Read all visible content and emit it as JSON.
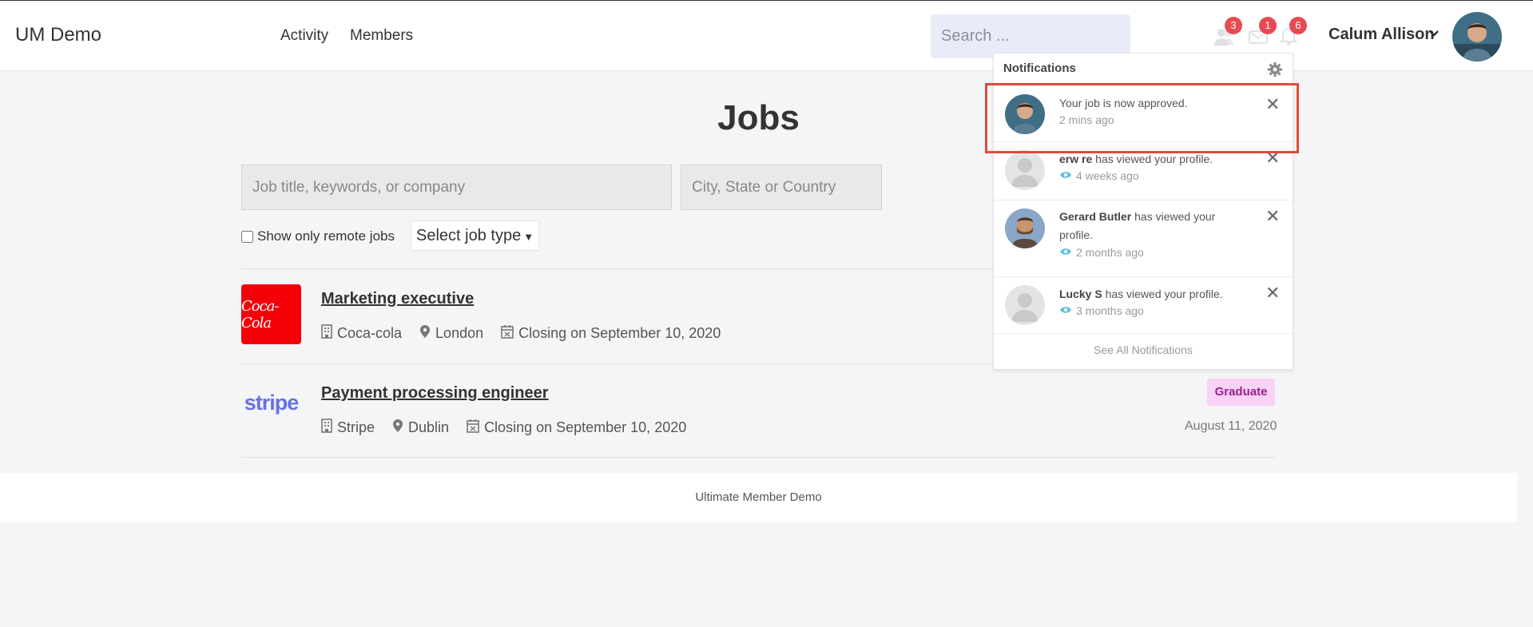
{
  "header": {
    "brand": "UM Demo",
    "nav": [
      "Activity",
      "Members"
    ],
    "search_placeholder": "Search ...",
    "badges": {
      "friends": "3",
      "messages": "1",
      "notifications": "6"
    },
    "user_name": "Calum Allison"
  },
  "main": {
    "title": "Jobs",
    "keyword_placeholder": "Job title, keywords, or company",
    "location_placeholder": "City, State or Country",
    "remote_label": "Show only remote jobs",
    "job_type_selected": "Select job type",
    "jobs": [
      {
        "title": "Marketing executive",
        "company": "Coca-cola",
        "location": "London",
        "closing": "Closing on September 10, 2020",
        "logo_text": "Coca-Cola"
      },
      {
        "title": "Payment processing engineer",
        "company": "Stripe",
        "location": "Dublin",
        "closing": "Closing on September 10, 2020",
        "logo_text": "stripe",
        "badge": "Graduate",
        "posted": "August 11, 2020"
      }
    ]
  },
  "footer": {
    "text": "Ultimate Member Demo"
  },
  "notifications": {
    "heading": "Notifications",
    "items": [
      {
        "name": "",
        "text": "Your job is now approved.",
        "time": "2 mins ago"
      },
      {
        "name": "erw re",
        "text": " has viewed your profile.",
        "time": "4 weeks ago"
      },
      {
        "name": "Gerard Butler",
        "text": " has viewed your profile.",
        "time": "2 months ago"
      },
      {
        "name": "Lucky S",
        "text": " has viewed your profile.",
        "time": "3 months ago"
      }
    ],
    "see_all": "See All Notifications"
  },
  "colors": {
    "badge": "#e84a53",
    "highlight": "#e04a3a",
    "coke": "#f40009",
    "stripe": "#6772e5",
    "graduate_bg": "#f9d2f6"
  }
}
